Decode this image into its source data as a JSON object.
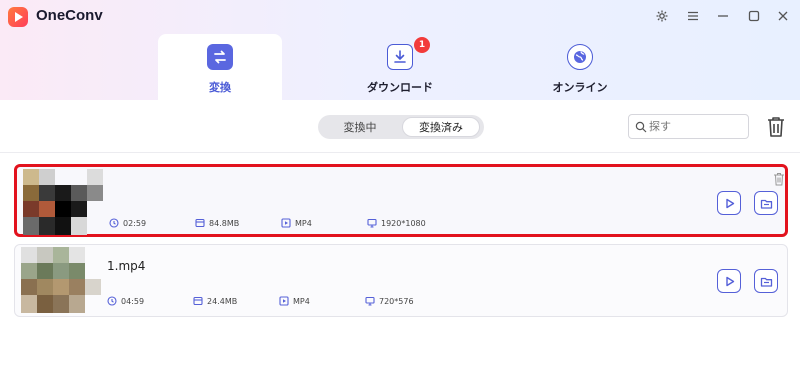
{
  "app": {
    "title": "OneConv"
  },
  "tabs": [
    {
      "label": "変換",
      "icon": "convert-icon",
      "active": true
    },
    {
      "label": "ダウンロード",
      "icon": "download-icon",
      "badge": "1"
    },
    {
      "label": "オンライン",
      "icon": "globe-icon"
    }
  ],
  "segment": {
    "options": [
      "変換中",
      "変換済み"
    ],
    "selected": "変換済み"
  },
  "search": {
    "placeholder": "探す",
    "value": ""
  },
  "files": [
    {
      "name": "",
      "duration": "02:59",
      "size": "84.8MB",
      "format": "MP4",
      "resolution": "1920*1080",
      "highlighted": true
    },
    {
      "name": "1.mp4",
      "duration": "04:59",
      "size": "24.4MB",
      "format": "MP4",
      "resolution": "720*576",
      "highlighted": false
    }
  ],
  "colors": {
    "accent": "#4b5bd6",
    "highlight": "#e2121d",
    "badge": "#f23b3b"
  }
}
